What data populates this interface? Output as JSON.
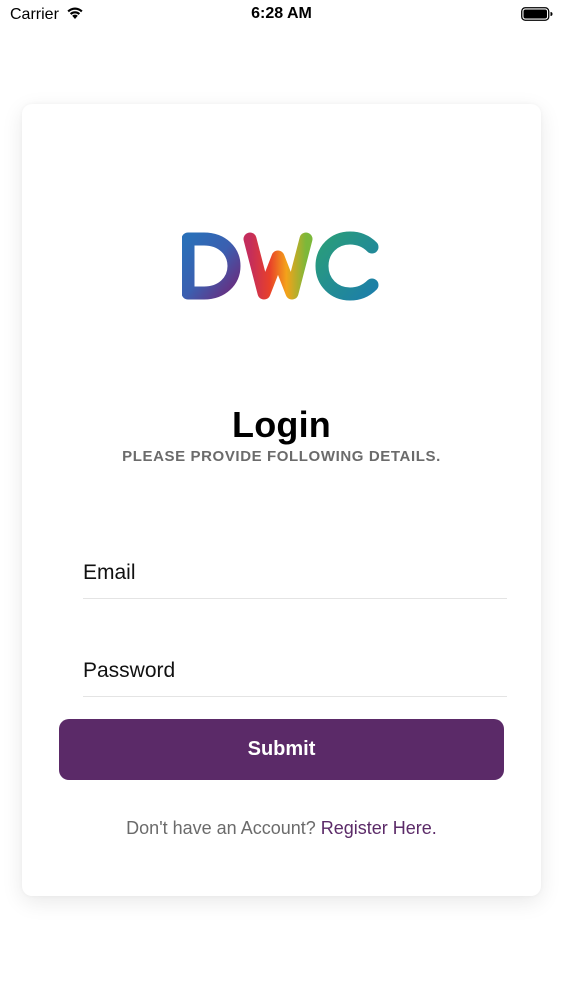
{
  "status_bar": {
    "carrier": "Carrier",
    "time": "6:28 AM",
    "icons": [
      "wifi-icon",
      "battery-icon"
    ]
  },
  "logo": {
    "text": "DWC",
    "colors": [
      "#2f8fd6",
      "#6b2b7d",
      "#e8402a",
      "#f4a21a",
      "#7cb83a",
      "#1a8f8f"
    ]
  },
  "login": {
    "title": "Login",
    "subtitle": "PLEASE PROVIDE FOLLOWING DETAILS."
  },
  "form": {
    "email_placeholder": "Email",
    "email_value": "",
    "password_placeholder": "Password",
    "password_value": "",
    "submit_label": "Submit"
  },
  "register": {
    "prompt": "Don't have an Account? ",
    "link_label": "Register Here",
    "suffix": "."
  },
  "colors": {
    "primary": "#5b2a68",
    "muted_text": "#6b6b6b",
    "divider": "#e4e4e4"
  }
}
